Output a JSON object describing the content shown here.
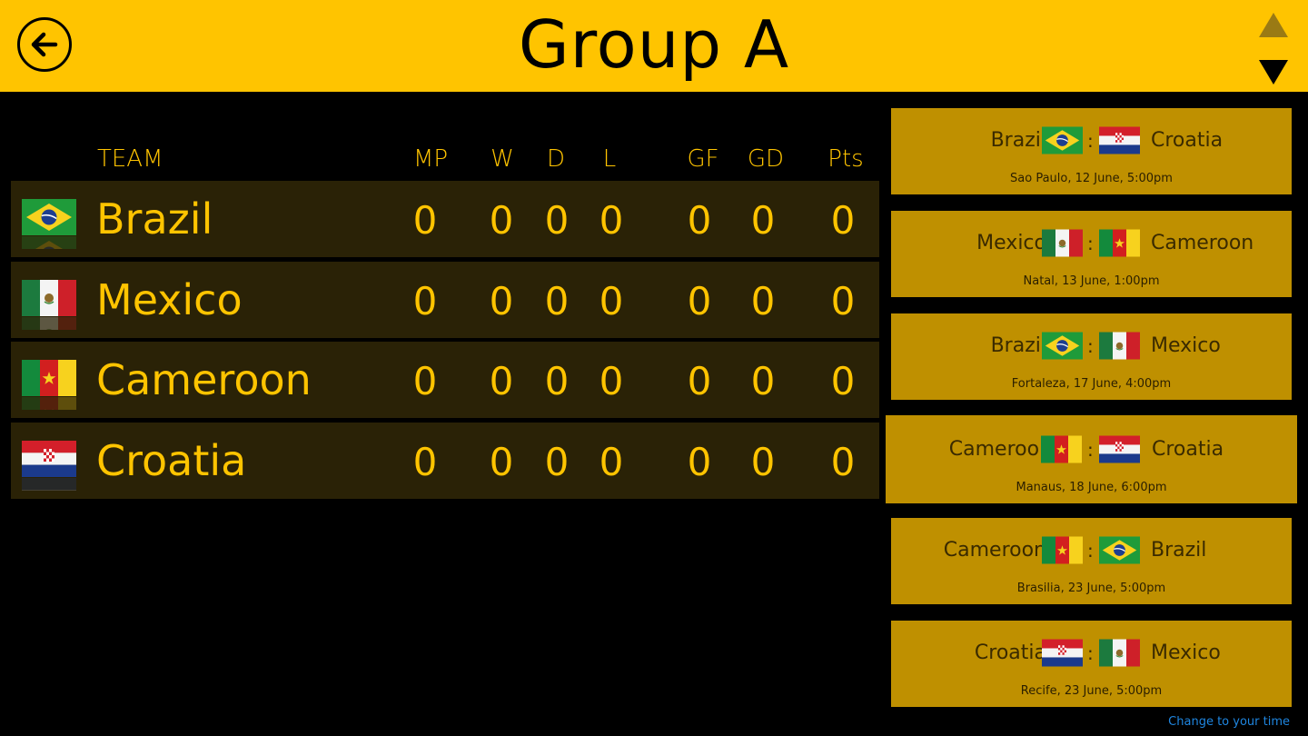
{
  "header": {
    "title": "Group A"
  },
  "table": {
    "headers": {
      "team": "TEAM",
      "mp": "MP",
      "w": "W",
      "d": "D",
      "l": "L",
      "gf": "GF",
      "gd": "GD",
      "pts": "Pts"
    },
    "rows": [
      {
        "team": "Brazil",
        "flag": "brazil-flag",
        "mp": "0",
        "w": "0",
        "d": "0",
        "l": "0",
        "gf": "0",
        "gd": "0",
        "pts": "0"
      },
      {
        "team": "Mexico",
        "flag": "mexico-flag",
        "mp": "0",
        "w": "0",
        "d": "0",
        "l": "0",
        "gf": "0",
        "gd": "0",
        "pts": "0"
      },
      {
        "team": "Cameroon",
        "flag": "cameroon-flag",
        "mp": "0",
        "w": "0",
        "d": "0",
        "l": "0",
        "gf": "0",
        "gd": "0",
        "pts": "0"
      },
      {
        "team": "Croatia",
        "flag": "croatia-flag",
        "mp": "0",
        "w": "0",
        "d": "0",
        "l": "0",
        "gf": "0",
        "gd": "0",
        "pts": "0"
      }
    ]
  },
  "matches": [
    {
      "home": "Brazil",
      "away": "Croatia",
      "separator": ":",
      "info": "Sao Paulo, 12 June, 5:00pm"
    },
    {
      "home": "Mexico",
      "away": "Cameroon",
      "separator": ":",
      "info": "Natal, 13 June, 1:00pm"
    },
    {
      "home": "Brazil",
      "away": "Mexico",
      "separator": ":",
      "info": "Fortaleza, 17 June, 4:00pm"
    },
    {
      "home": "Cameroon",
      "away": "Croatia",
      "separator": ":",
      "info": "Manaus, 18 June, 6:00pm"
    },
    {
      "home": "Cameroon",
      "away": "Brazil",
      "separator": ":",
      "info": "Brasilia, 23 June, 5:00pm"
    },
    {
      "home": "Croatia",
      "away": "Mexico",
      "separator": ":",
      "info": "Recife, 23 June, 5:00pm"
    }
  ],
  "footer": {
    "change_time_label": "Change to your time"
  },
  "colors": {
    "header_bg": "#FFC400",
    "accent": "#FFC400",
    "row_bg": "#2A2206",
    "match_bg": "#BF9000",
    "link": "#1F86E0"
  }
}
